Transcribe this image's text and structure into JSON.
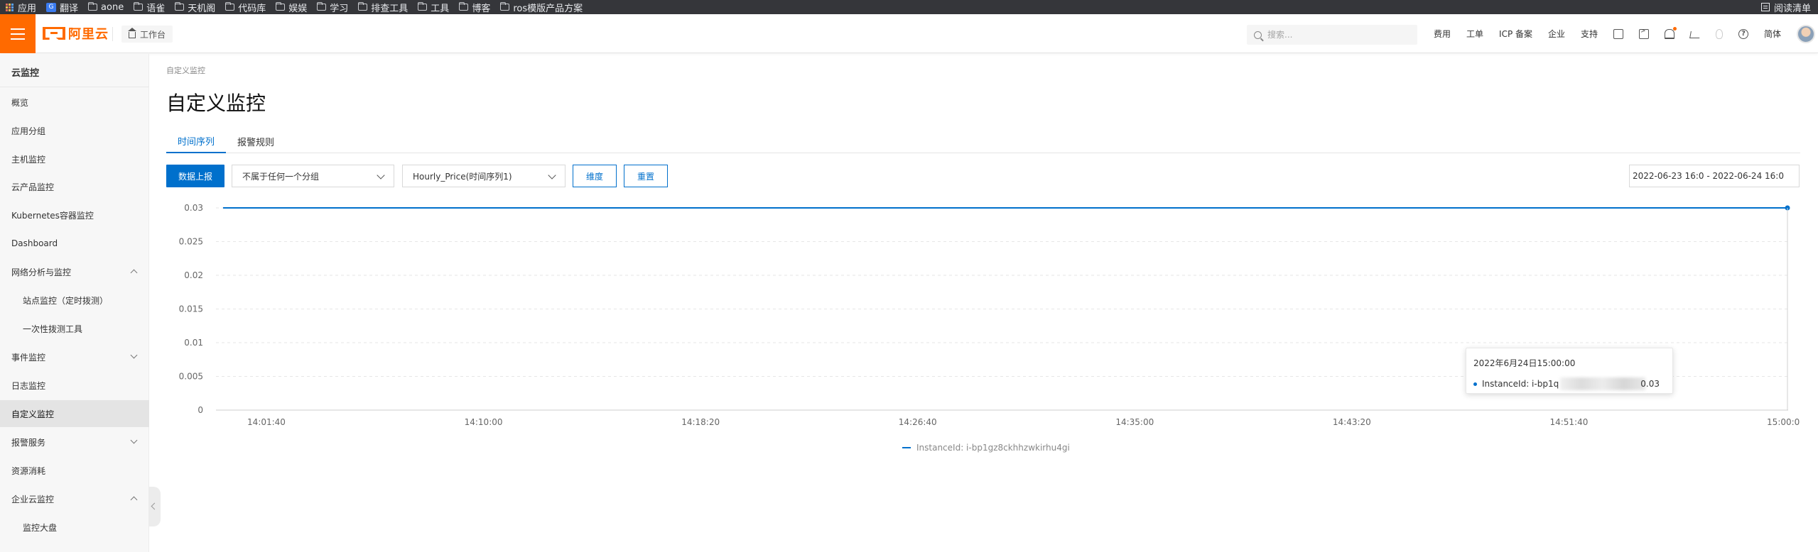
{
  "bookmarks": {
    "apps_label": "应用",
    "translate_label": "翻译",
    "items": [
      "aone",
      "语雀",
      "天机阁",
      "代码库",
      "娱娱",
      "学习",
      "排查工具",
      "工具",
      "博客",
      "ros模版产品方案"
    ],
    "reading_list": "阅读清单"
  },
  "topnav": {
    "logo": "阿里云",
    "workbench": "工作台",
    "search_placeholder": "搜索...",
    "links": [
      "费用",
      "工单",
      "ICP 备案",
      "企业",
      "支持"
    ],
    "lang": "简体",
    "accent_color": "#ff6a00"
  },
  "sidebar": {
    "title": "云监控",
    "items": [
      {
        "label": "概览"
      },
      {
        "label": "应用分组"
      },
      {
        "label": "主机监控"
      },
      {
        "label": "云产品监控"
      },
      {
        "label": "Kubernetes容器监控"
      },
      {
        "label": "Dashboard"
      },
      {
        "label": "网络分析与监控"
      },
      {
        "label": "站点监控（定时拨测）"
      },
      {
        "label": "一次性拨测工具"
      },
      {
        "label": "事件监控"
      },
      {
        "label": "日志监控"
      },
      {
        "label": "自定义监控"
      },
      {
        "label": "报警服务"
      },
      {
        "label": "资源消耗"
      },
      {
        "label": "企业云监控"
      },
      {
        "label": "监控大盘"
      }
    ]
  },
  "main": {
    "breadcrumb": "自定义监控",
    "title": "自定义监控",
    "tabs": [
      {
        "label": "时间序列"
      },
      {
        "label": "报警规则"
      }
    ],
    "toolbar": {
      "report_button": "数据上报",
      "group_select": "不属于任何一个分组",
      "metric_select": "Hourly_Price(时间序列1)",
      "dimension_button": "维度",
      "reset_button": "重置",
      "date_range": "2022-06-23 16:0 - 2022-06-24 16:0"
    },
    "tooltip": {
      "title": "2022年6月24日15:00:00",
      "label": "InstanceId: i-bp1q",
      "value": "0.03"
    }
  },
  "chart_data": {
    "type": "line",
    "x_ticks": [
      "14:01:40",
      "14:10:00",
      "14:18:20",
      "14:26:40",
      "14:35:00",
      "14:43:20",
      "14:51:40",
      "15:00:00"
    ],
    "y_ticks": [
      "0.03",
      "0.025",
      "0.02",
      "0.015",
      "0.01",
      "0.005",
      "0"
    ],
    "ylim": [
      0,
      0.03
    ],
    "series": [
      {
        "name": "InstanceId: i-bp1gz8ckhhzwkirhu4gi",
        "color": "#0070cc",
        "x": [
          "14:01:40",
          "15:00:00"
        ],
        "values": [
          0.03,
          0.03
        ]
      }
    ],
    "grid": "horizontal-dashed",
    "legend": "bottom-center"
  }
}
